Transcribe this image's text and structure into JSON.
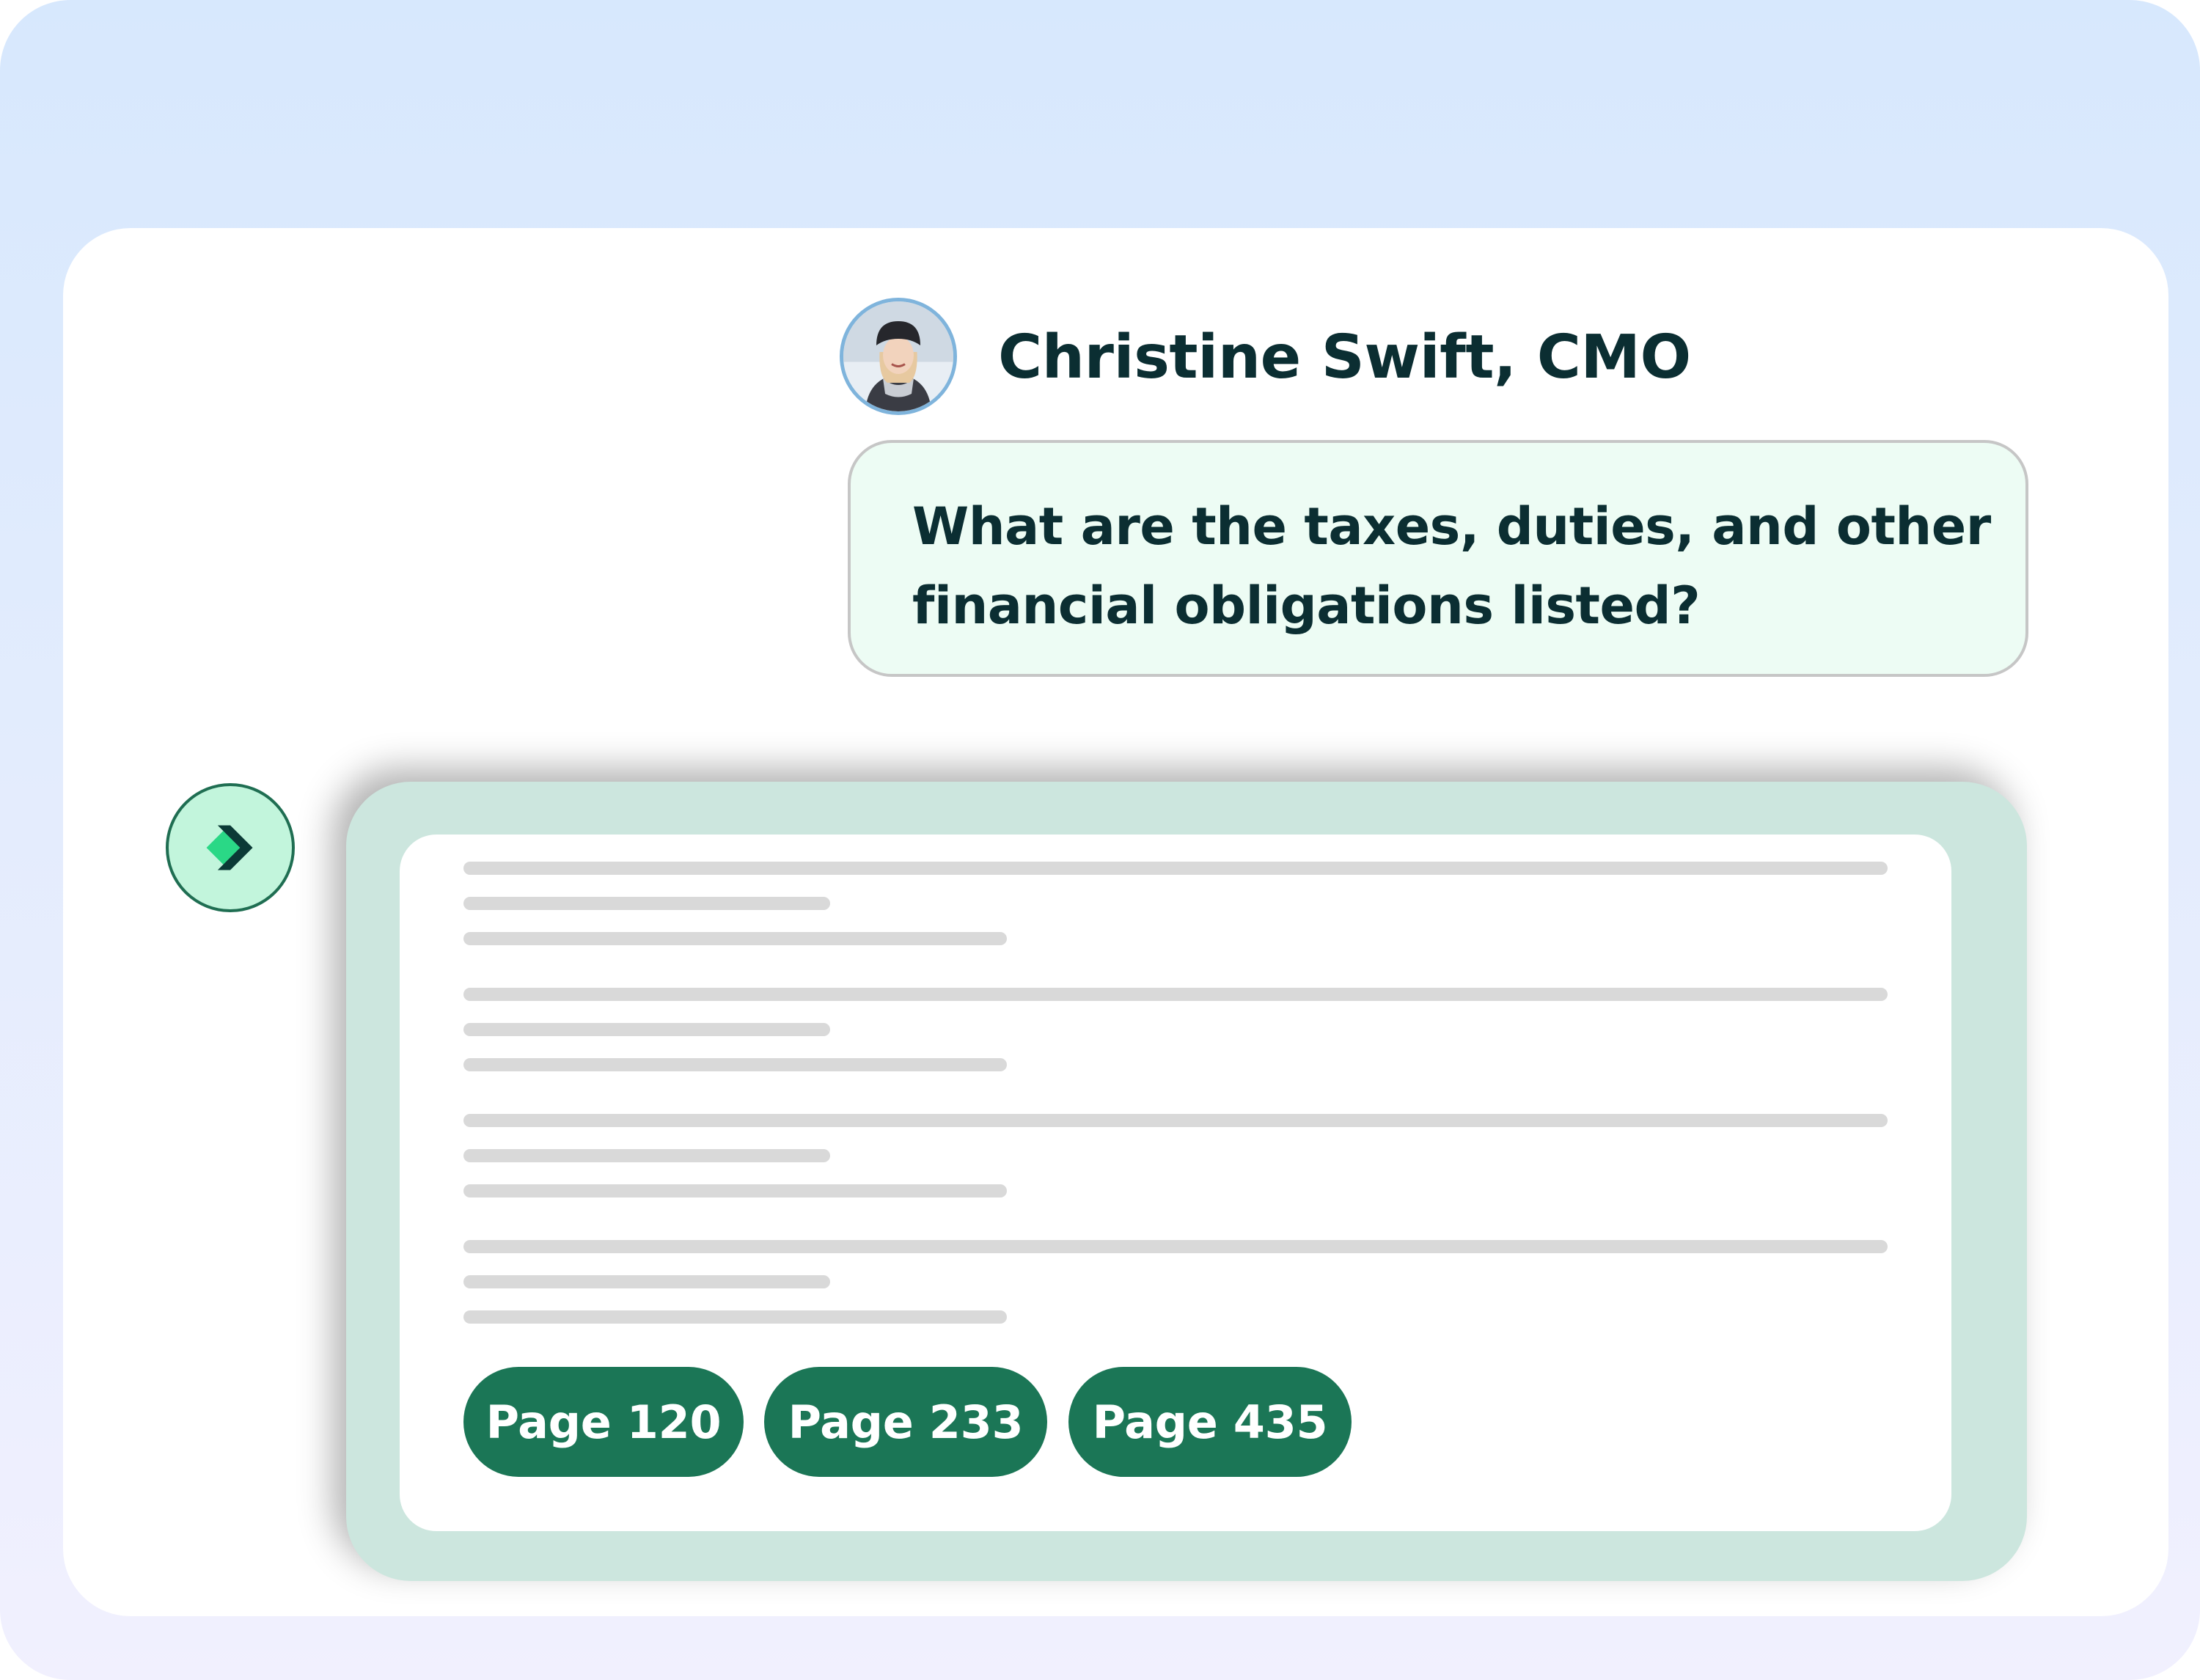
{
  "user": {
    "name": "Christine Swift, CMO",
    "question": "What are the taxes, duties, and other financial obligations listed?"
  },
  "answer": {
    "paragraph_count": 4,
    "page_chips": [
      "Page 120",
      "Page 233",
      "Page 435"
    ]
  },
  "colors": {
    "accent_dark_green": "#1b7656",
    "card_green": "#cce6de",
    "bubble_bg": "#edfcf4",
    "text_dark": "#0b2e32",
    "logo_bright": "#2ad886",
    "logo_dark": "#0b3a36"
  },
  "icons": {
    "bot": "assistant-logo-icon",
    "user": "avatar"
  }
}
